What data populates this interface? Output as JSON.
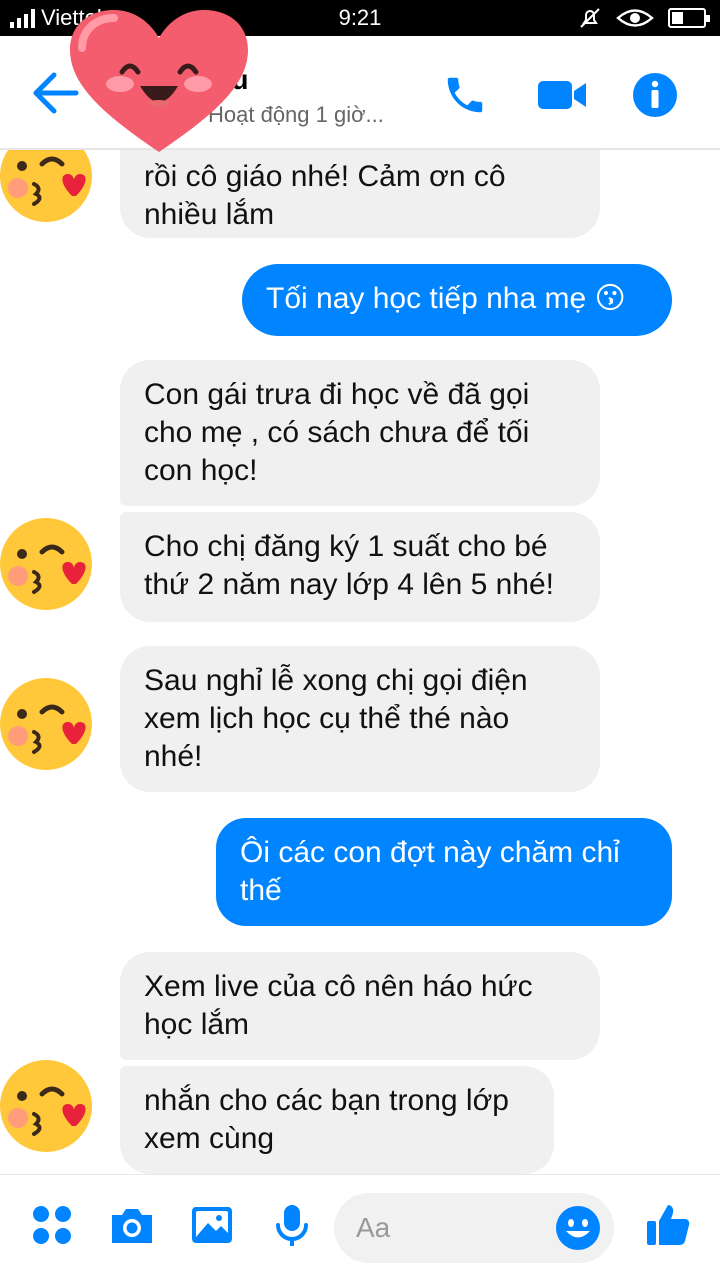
{
  "status_bar": {
    "carrier": "Viettel",
    "time": "9:21",
    "battery_level": 0.35
  },
  "header": {
    "contact_name": "...u",
    "contact_status": "Hoạt động 1 giờ...",
    "icons": [
      "back-arrow-icon",
      "phone-icon",
      "video-camera-icon",
      "info-icon"
    ]
  },
  "messages": [
    {
      "direction": "in",
      "text": "rồi cô giáo nhé! Cảm ơn cô\nnhiều lắm"
    },
    {
      "direction": "out",
      "text": "Tối nay học tiếp nha mẹ 😗"
    },
    {
      "direction": "in",
      "text": "Con gái trưa đi học về đã gọi\ncho mẹ , có sách chưa để tối\ncon học!"
    },
    {
      "direction": "in",
      "text": "Cho chị đăng ký 1 suất cho bé\nthứ 2 năm nay lớp 4 lên 5 nhé!"
    },
    {
      "direction": "in",
      "text": "Sau nghỉ lễ xong chị gọi điện\nxem lịch học cụ thể thé nào\nnhé!"
    },
    {
      "direction": "out",
      "text": "Ôi các con đợt này chăm chỉ\nthế"
    },
    {
      "direction": "in",
      "text": "Xem live của cô nên háo hức\nhọc lắm"
    },
    {
      "direction": "in",
      "text": "nhắn cho các bạn trong lớp\nxem cùng"
    }
  ],
  "composer": {
    "placeholder": "Aa",
    "icons": [
      "apps-grid-icon",
      "camera-icon",
      "image-icon",
      "microphone-icon",
      "emoji-icon",
      "thumbs-up-icon"
    ]
  },
  "colors": {
    "accent": "#0084ff",
    "incoming_bubble": "#f1f0f0",
    "status_bar": "#000000"
  }
}
